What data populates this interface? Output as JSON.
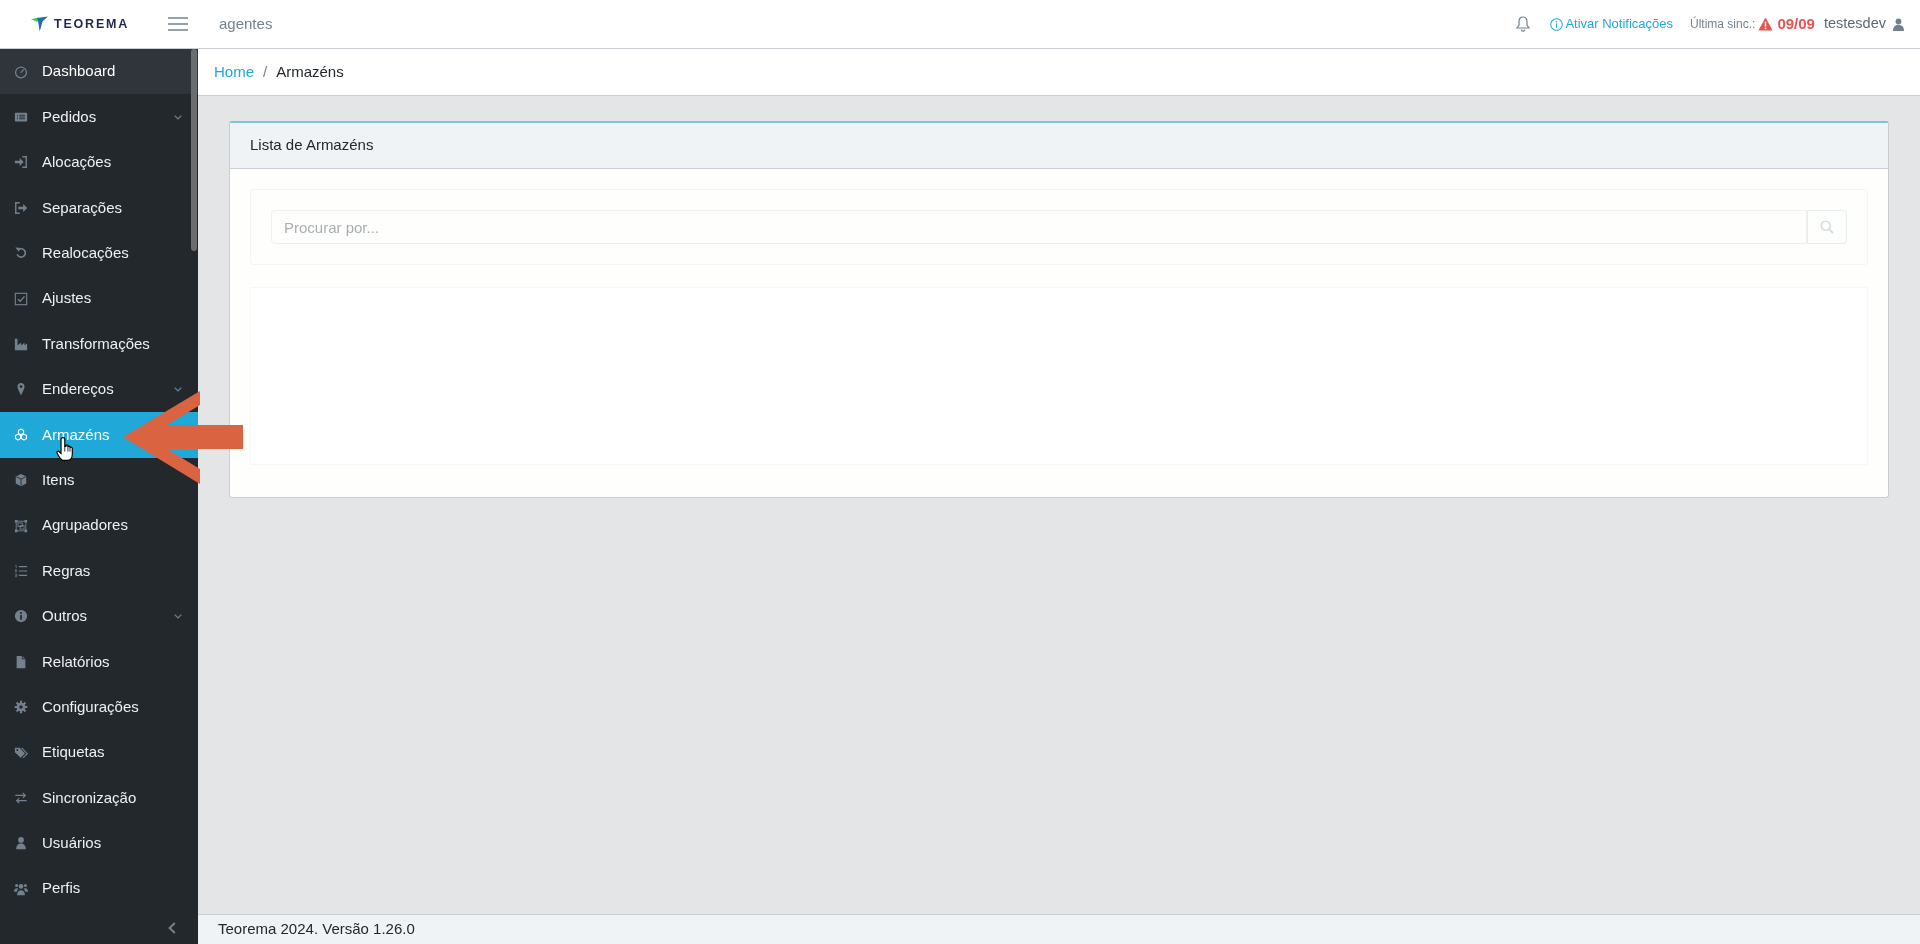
{
  "header": {
    "logo": {
      "text": "TEOREMA"
    },
    "section_title": "agentes",
    "notifications_link": "Ativar Notificações",
    "sync": {
      "label": "Última sinc.:",
      "warning": true,
      "value": "09/09"
    },
    "user": "testesdev"
  },
  "sidebar": {
    "items": [
      {
        "label": "Dashboard",
        "selected": false,
        "hovered": true,
        "expandable": false
      },
      {
        "label": "Pedidos",
        "selected": false,
        "hovered": false,
        "expandable": true
      },
      {
        "label": "Alocações",
        "selected": false,
        "hovered": false,
        "expandable": false
      },
      {
        "label": "Separações",
        "selected": false,
        "hovered": false,
        "expandable": false
      },
      {
        "label": "Realocações",
        "selected": false,
        "hovered": false,
        "expandable": false
      },
      {
        "label": "Ajustes",
        "selected": false,
        "hovered": false,
        "expandable": false
      },
      {
        "label": "Transformações",
        "selected": false,
        "hovered": false,
        "expandable": false
      },
      {
        "label": "Endereços",
        "selected": false,
        "hovered": false,
        "expandable": true
      },
      {
        "label": "Armazéns",
        "selected": true,
        "hovered": false,
        "expandable": false
      },
      {
        "label": "Itens",
        "selected": false,
        "hovered": false,
        "expandable": false
      },
      {
        "label": "Agrupadores",
        "selected": false,
        "hovered": false,
        "expandable": false
      },
      {
        "label": "Regras",
        "selected": false,
        "hovered": false,
        "expandable": false
      },
      {
        "label": "Outros",
        "selected": false,
        "hovered": false,
        "expandable": true
      },
      {
        "label": "Relatórios",
        "selected": false,
        "hovered": false,
        "expandable": false
      },
      {
        "label": "Configurações",
        "selected": false,
        "hovered": false,
        "expandable": false
      },
      {
        "label": "Etiquetas",
        "selected": false,
        "hovered": false,
        "expandable": false
      },
      {
        "label": "Sincronização",
        "selected": false,
        "hovered": false,
        "expandable": false
      },
      {
        "label": "Usuários",
        "selected": false,
        "hovered": false,
        "expandable": false
      },
      {
        "label": "Perfis",
        "selected": false,
        "hovered": false,
        "expandable": false
      }
    ]
  },
  "breadcrumb": {
    "separator": "/",
    "items": [
      {
        "label": "Home",
        "kind": "link"
      },
      {
        "label": "Armazéns",
        "kind": "current"
      }
    ]
  },
  "card": {
    "title": "Lista de Armazéns",
    "search": {
      "placeholder": "Procurar por..."
    }
  },
  "footer": {
    "text": "Teorema 2024. Versão 1.26.0"
  }
}
